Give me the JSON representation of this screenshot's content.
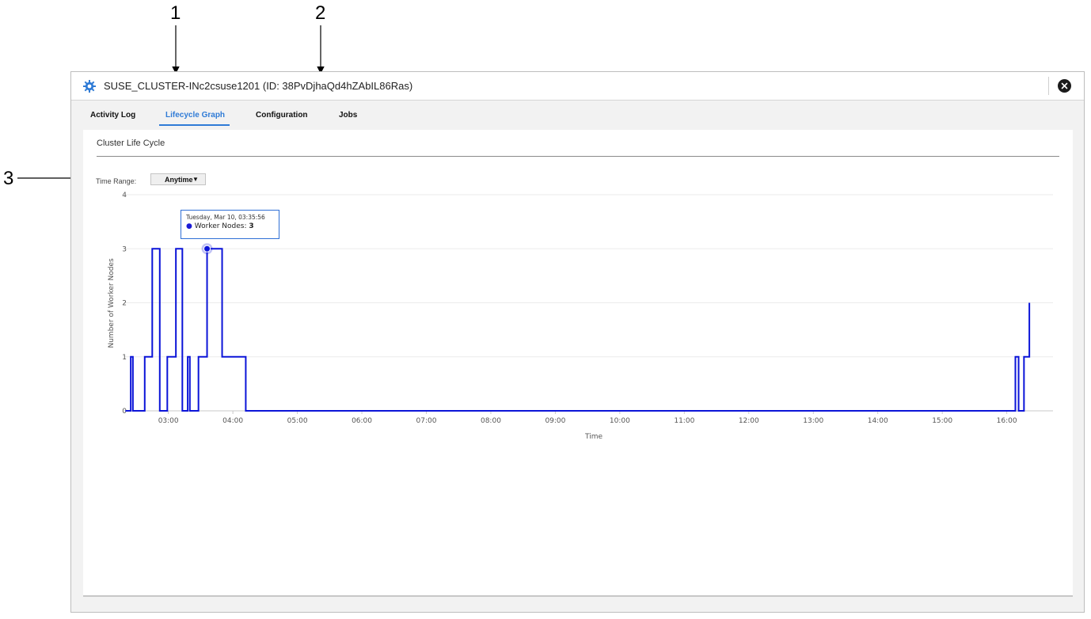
{
  "callouts": [
    "1",
    "2",
    "3"
  ],
  "window": {
    "title": "SUSE_CLUSTER-INc2csuse1201 (ID: 38PvDjhaQd4hZAbIL86Ras)",
    "app_icon": "cluster-gear-icon",
    "close_icon": "close-icon"
  },
  "tabs": [
    {
      "label": "Activity Log",
      "active": false
    },
    {
      "label": "Lifecycle Graph",
      "active": true
    },
    {
      "label": "Configuration",
      "active": false
    },
    {
      "label": "Jobs",
      "active": false
    }
  ],
  "panel": {
    "title": "Cluster Life Cycle",
    "time_range_label": "Time Range:",
    "time_range_value": "Anytime",
    "time_range_caret": "▼"
  },
  "tooltip": {
    "date": "Tuesday, Mar 10, 03:35:56",
    "series": "Worker Nodes",
    "value": "3"
  },
  "colors": {
    "series": "#0b14d8",
    "accent": "#2f7bd6"
  },
  "chart_data": {
    "type": "line",
    "step": true,
    "xlabel": "Time",
    "ylabel": "Number of Worker Nodes",
    "y_ticks": [
      "0",
      "1",
      "2",
      "3",
      "4"
    ],
    "ylim": [
      0,
      4
    ],
    "x_ticks": [
      "03:00",
      "04:00",
      "05:00",
      "06:00",
      "07:00",
      "08:00",
      "09:00",
      "10:00",
      "11:00",
      "12:00",
      "13:00",
      "14:00",
      "15:00",
      "16:00"
    ],
    "xlim": [
      "02:19",
      "16:43"
    ],
    "grid": true,
    "series": [
      {
        "name": "Worker Nodes",
        "points": [
          [
            "02:20",
            0
          ],
          [
            "02:25",
            1
          ],
          [
            "02:27",
            0
          ],
          [
            "02:38",
            1
          ],
          [
            "02:45",
            3
          ],
          [
            "02:52",
            0
          ],
          [
            "02:59",
            1
          ],
          [
            "03:07",
            3
          ],
          [
            "03:13",
            0
          ],
          [
            "03:18",
            1
          ],
          [
            "03:20",
            0
          ],
          [
            "03:28",
            1
          ],
          [
            "03:36",
            3
          ],
          [
            "03:50",
            1
          ],
          [
            "04:12",
            0
          ],
          [
            "16:08",
            1
          ],
          [
            "16:11",
            0
          ],
          [
            "16:16",
            1
          ],
          [
            "16:21",
            2
          ]
        ]
      }
    ],
    "highlight": {
      "x": "03:36",
      "y": 3
    }
  }
}
